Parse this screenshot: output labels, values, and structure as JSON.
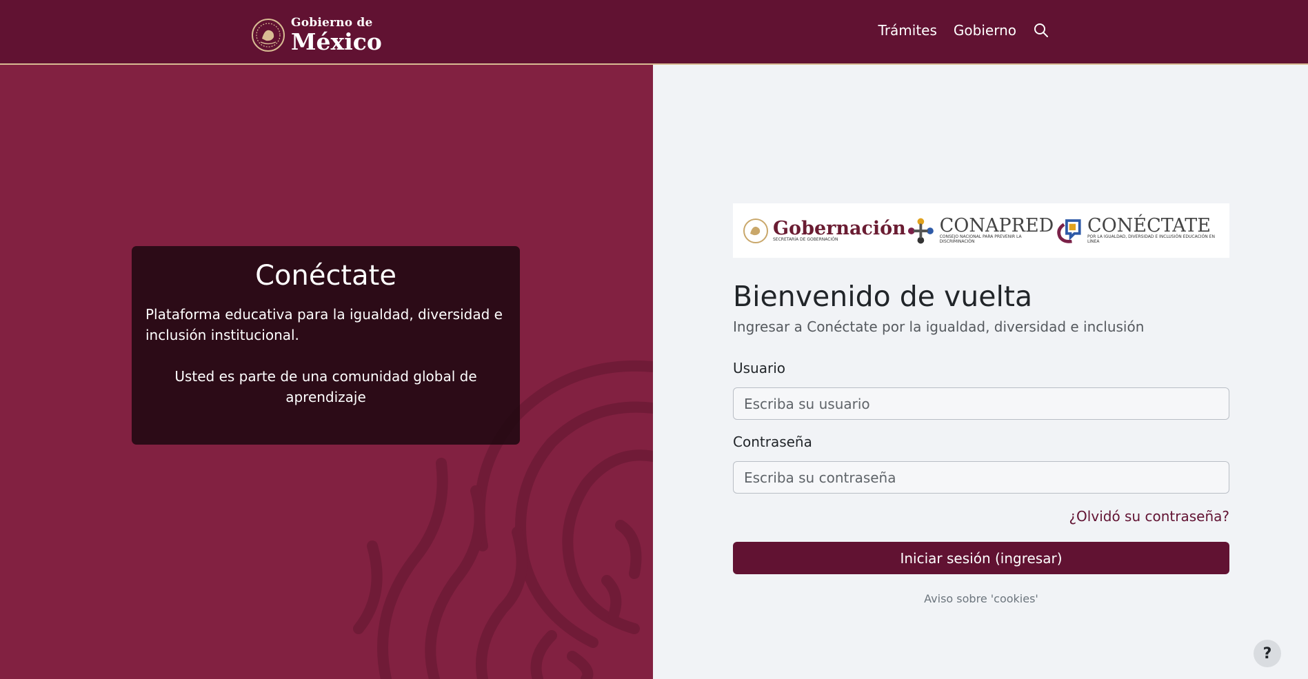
{
  "navbar": {
    "brand_small": "Gobierno de",
    "brand_big": "México",
    "links": [
      {
        "label": "Trámites"
      },
      {
        "label": "Gobierno"
      }
    ],
    "search_icon": "search-icon"
  },
  "hero": {
    "title": "Conéctate",
    "description": "Plataforma educativa para la igualdad, diversidad e inclusión institucional.",
    "tagline": "Usted es parte de una comunidad global de aprendizaje"
  },
  "logos": {
    "gobernacion": {
      "name": "Gobernación",
      "sub": "Secretaría de Gobernación"
    },
    "conapred": {
      "name": "CONAPRED",
      "sub": "Consejo Nacional para Prevenir la Discriminación"
    },
    "conectate": {
      "name": "CONÉCTATE",
      "sub": "Por la igualdad, diversidad e inclusión educación en línea"
    }
  },
  "login": {
    "heading": "Bienvenido de vuelta",
    "subtitle": "Ingresar a Conéctate por la igualdad, diversidad e inclusión",
    "username_label": "Usuario",
    "username_placeholder": "Escriba su usuario",
    "password_label": "Contraseña",
    "password_placeholder": "Escriba su contraseña",
    "forgot_label": "¿Olvidó su contraseña?",
    "submit_label": "Iniciar sesión (ingresar)",
    "cookies_label": "Aviso sobre 'cookies'"
  },
  "help": {
    "label": "?"
  },
  "colors": {
    "primary": "#611232",
    "hero_background": "#822141",
    "accent_border": "#d8bc93",
    "page_background": "#f1f3f6"
  }
}
